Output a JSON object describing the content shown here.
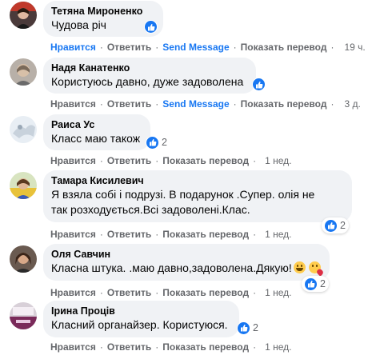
{
  "actions": {
    "like": "Нравится",
    "reply": "Ответить",
    "send_message": "Send Message",
    "show_translation": "Показать перевод",
    "separator": "·"
  },
  "comments": [
    {
      "author": "Тетяна Мироненко",
      "text": "Чудова річ",
      "reactions": "",
      "time": "19 ч.",
      "has_send_message": true
    },
    {
      "author": "Надя Канатенко",
      "text": "Користуюсь давно, дуже задоволена",
      "reactions": "",
      "time": "3 д.",
      "has_send_message": true
    },
    {
      "author": "Раиса Ус",
      "text": "Класс маю також",
      "reactions": "2",
      "time": "1 нед.",
      "has_send_message": false
    },
    {
      "author": "Тамара Кисилевич",
      "text_line1": "Я взяла собі і подрузі.  В подарунок .Супер. олія  не",
      "text_line2": "так розходується.Всі задоволені.Клас.",
      "reactions": "2",
      "time": "1 нед.",
      "has_send_message": false
    },
    {
      "author": "Оля Савчин",
      "text": "Класна штука. .маю давно,задоволена.Дякую!",
      "reactions": "2",
      "time": "1 нед.",
      "has_send_message": false
    },
    {
      "author": "Ірина Проців",
      "text": "Класний органайзер. Користуюся.",
      "reactions": "2",
      "time": "1 нед.",
      "has_send_message": false
    }
  ],
  "colors": {
    "like_blue": "#1877f2",
    "bubble_bg": "#f0f2f5",
    "meta_gray": "#65676b"
  },
  "icons": {
    "like": "thumbs-up-icon"
  }
}
